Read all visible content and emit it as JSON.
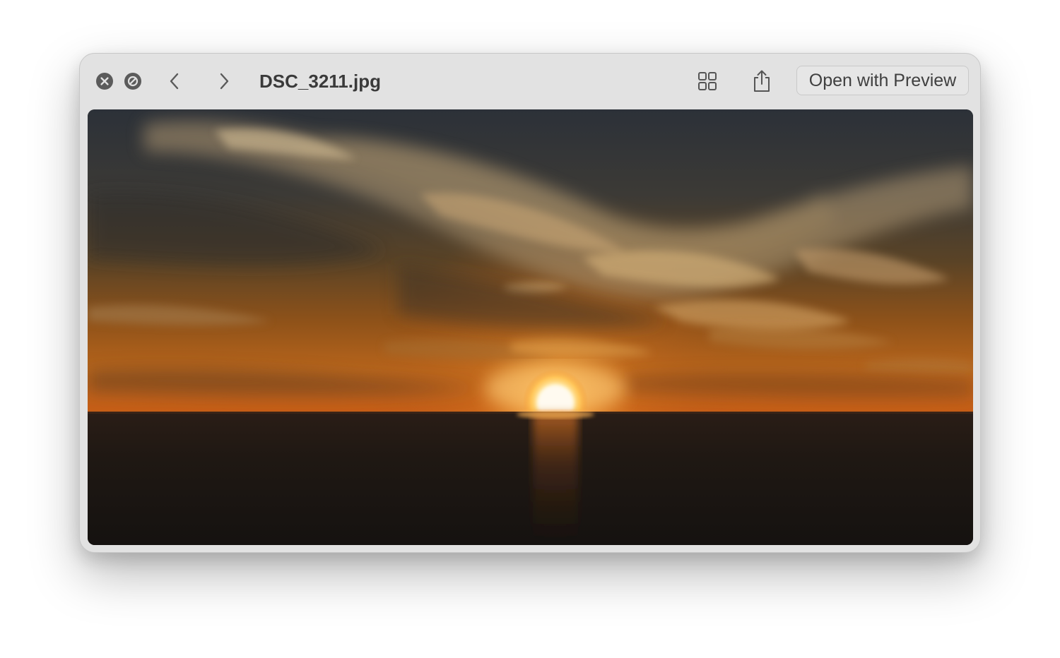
{
  "window": {
    "title": "DSC_3211.jpg",
    "open_button_label": "Open with Preview"
  },
  "icons": {
    "close": "close-icon",
    "do_not_disturb": "block-icon",
    "back": "chevron-left-icon",
    "forward": "chevron-right-icon",
    "grid": "grid-icon",
    "share": "share-icon"
  },
  "photo": {
    "description_scene": "sunset over ocean with wispy clouds"
  },
  "colors": {
    "toolbar_bg": "#e2e2e2",
    "icon_gray": "#555555",
    "title_text": "#3a3a3a"
  }
}
